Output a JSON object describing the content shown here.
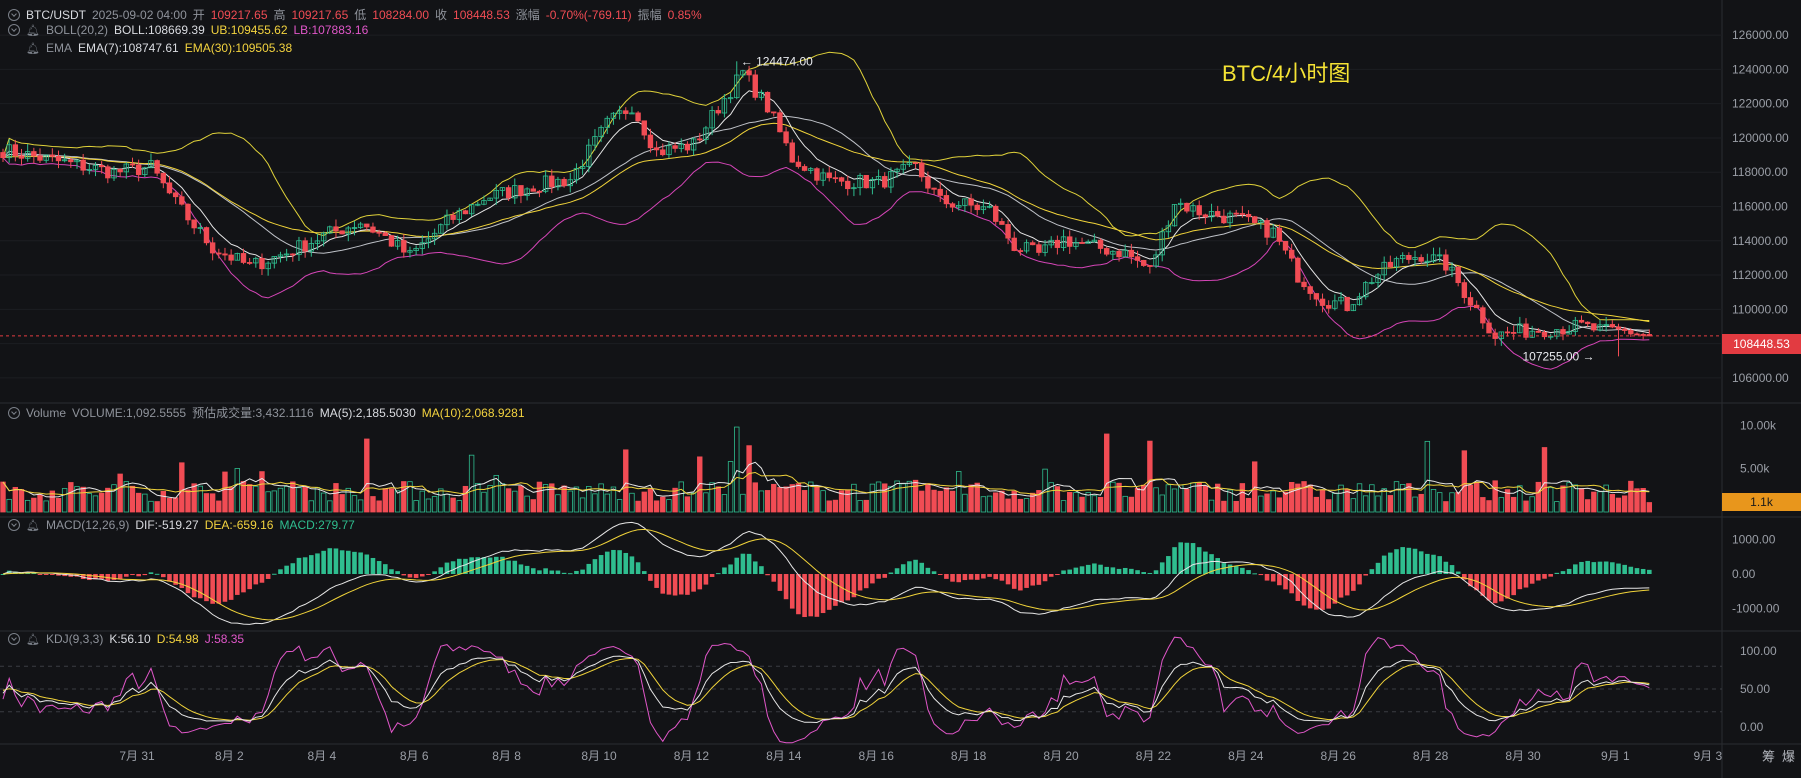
{
  "header": {
    "symbol": "BTC/USDT",
    "datetime": "2025-09-02 04:00",
    "open_label": "开",
    "open": "109217.65",
    "high_label": "高",
    "high": "109217.65",
    "low_label": "低",
    "low": "108284.00",
    "close_label": "收",
    "close": "108448.53",
    "change_label": "涨幅",
    "change": "-0.70%(-769.11)",
    "amp_label": "振幅",
    "amp": "0.85%"
  },
  "boll": {
    "name": "BOLL(20,2)",
    "mid": "BOLL:108669.39",
    "ub": "UB:109455.62",
    "lb": "LB:107883.16"
  },
  "ema": {
    "name": "EMA",
    "ema7": "EMA(7):108747.61",
    "ema30": "EMA(30):109505.38"
  },
  "volume": {
    "name": "Volume",
    "value": "VOLUME:1,092.5555",
    "est": "预估成交量:3,432.1116",
    "ma5": "MA(5):2,185.5030",
    "ma10": "MA(10):2,068.9281"
  },
  "macd": {
    "name": "MACD(12,26,9)",
    "dif": "DIF:-519.27",
    "dea": "DEA:-659.16",
    "macd": "MACD:279.77"
  },
  "kdj": {
    "name": "KDJ(9,3,3)",
    "k": "K:56.10",
    "d": "D:54.98",
    "j": "J:58.35"
  },
  "title": "BTC/4小时图",
  "last_price": "108448.53",
  "last_volume": "1.1k",
  "annotations": {
    "high": "124474.00",
    "low": "107255.00"
  },
  "bottom_right": [
    "筹",
    "爆"
  ],
  "colors": {
    "up": "#2fbd8f",
    "down": "#f14c54",
    "boll_band": "#e0d23a",
    "lb_band": "#d545b7",
    "ema7": "#e6e6e6",
    "ema30": "#f0d33a",
    "kdj_k": "#e6e6e6",
    "kdj_d": "#f0d33a",
    "kdj_j": "#e056c8"
  },
  "chart_data": {
    "type": "candlestick",
    "timeframe": "4h",
    "x_tick_labels": [
      "7月 31",
      "8月 2",
      "8月 4",
      "8月 6",
      "8月 8",
      "8月 10",
      "8月 12",
      "8月 14",
      "8月 16",
      "8月 18",
      "8月 20",
      "8月 22",
      "8月 24",
      "8月 26",
      "8月 28",
      "8月 30",
      "9月 1",
      "9月 3"
    ],
    "price_axis": {
      "ticks": [
        "106000.00",
        "108000.00",
        "110000.00",
        "112000.00",
        "114000.00",
        "116000.00",
        "118000.00",
        "120000.00",
        "122000.00",
        "124000.00",
        "126000.00"
      ],
      "ylim": [
        105000,
        127000
      ]
    },
    "volume_axis": {
      "ticks": [
        "5.00k",
        "10.00k"
      ],
      "ylim": [
        0,
        12000
      ]
    },
    "macd_axis": {
      "ticks": [
        "1000.00",
        "0.00",
        "-1000.00"
      ],
      "ylim": [
        -1500,
        1500
      ]
    },
    "kdj_axis": {
      "ticks": [
        "100.00",
        "50.00",
        "0.00"
      ],
      "ylim": [
        -20,
        120
      ]
    },
    "close_waypoints": [
      [
        0,
        119300
      ],
      [
        8,
        118700
      ],
      [
        18,
        118000
      ],
      [
        24,
        118300
      ],
      [
        28,
        116200
      ],
      [
        34,
        113600
      ],
      [
        40,
        112500
      ],
      [
        46,
        113300
      ],
      [
        52,
        114300
      ],
      [
        58,
        115100
      ],
      [
        62,
        114200
      ],
      [
        66,
        113100
      ],
      [
        72,
        115100
      ],
      [
        78,
        116500
      ],
      [
        86,
        117200
      ],
      [
        92,
        117600
      ],
      [
        98,
        120800
      ],
      [
        102,
        121900
      ],
      [
        106,
        119200
      ],
      [
        112,
        119600
      ],
      [
        116,
        121800
      ],
      [
        120,
        123800
      ],
      [
        124,
        121800
      ],
      [
        128,
        118800
      ],
      [
        134,
        117500
      ],
      [
        142,
        117400
      ],
      [
        148,
        118300
      ],
      [
        152,
        116300
      ],
      [
        156,
        116100
      ],
      [
        160,
        115800
      ],
      [
        164,
        113700
      ],
      [
        168,
        113200
      ],
      [
        172,
        114100
      ],
      [
        176,
        113700
      ],
      [
        182,
        113300
      ],
      [
        186,
        112300
      ],
      [
        190,
        116300
      ],
      [
        194,
        115700
      ],
      [
        200,
        115300
      ],
      [
        206,
        114500
      ],
      [
        210,
        112000
      ],
      [
        214,
        110600
      ],
      [
        218,
        110200
      ],
      [
        222,
        111800
      ],
      [
        226,
        112800
      ],
      [
        230,
        113200
      ],
      [
        234,
        112600
      ],
      [
        238,
        110500
      ],
      [
        242,
        108500
      ],
      [
        248,
        108800
      ],
      [
        256,
        109000
      ],
      [
        260,
        108700
      ],
      [
        264,
        108700
      ],
      [
        267,
        108450
      ]
    ],
    "high_annotation": 124474.0,
    "low_annotation": 107255.0,
    "last_price": 108448.53
  }
}
